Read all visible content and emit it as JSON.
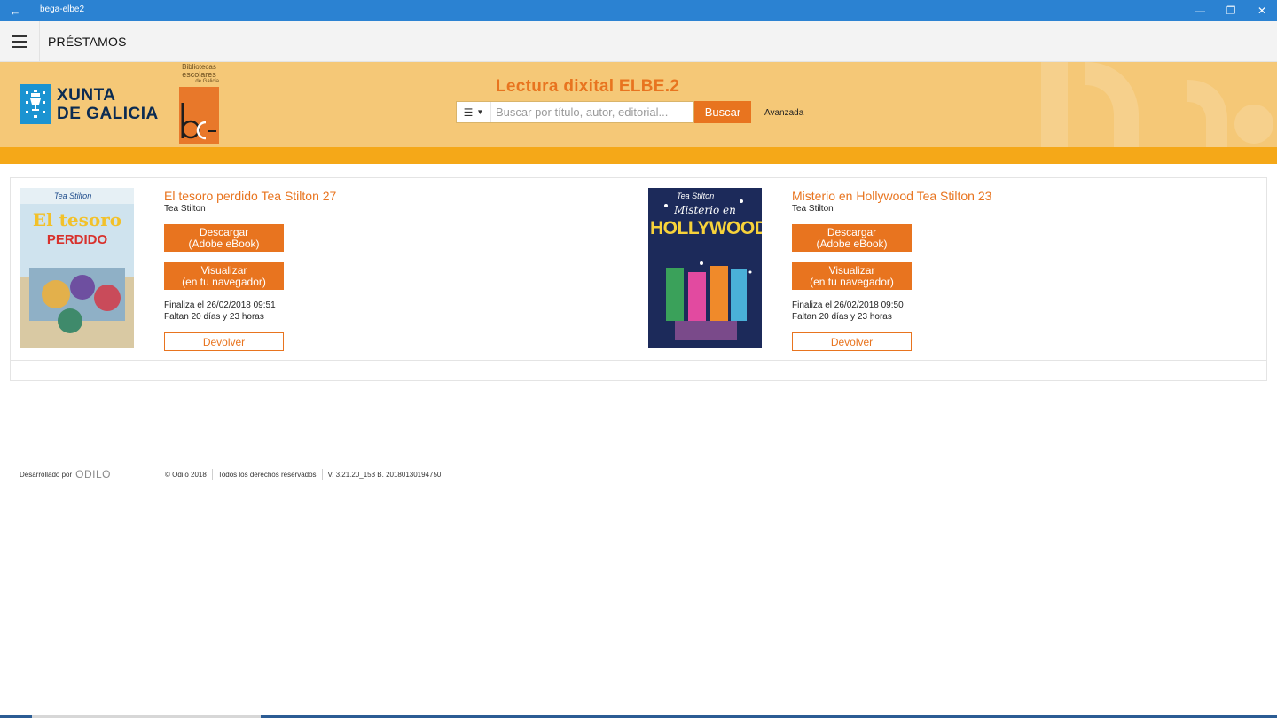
{
  "window": {
    "title": "bega-elbe2",
    "back_icon": "arrow-left-icon",
    "minimize": "—",
    "restore": "❐",
    "close": "✕"
  },
  "appbar": {
    "title": "PRÉSTAMOS"
  },
  "banner": {
    "xunta_line1": "XUNTA",
    "xunta_line2": "DE GALICIA",
    "bega_line1": "Bibliotecas",
    "bega_line2": "escolares",
    "bega_line3": "de Galicia",
    "title": "Lectura dixital ELBE.2",
    "search_placeholder": "Buscar por título, autor, editorial...",
    "search_button": "Buscar",
    "advanced": "Avanzada"
  },
  "loans": [
    {
      "title": "El tesoro perdido Tea Stilton 27",
      "author": "Tea Stilton",
      "download_line1": "Descargar",
      "download_line2": "(Adobe eBook)",
      "view_line1": "Visualizar",
      "view_line2": "(en tu navegador)",
      "ends": "Finaliza el 26/02/2018 09:51",
      "remaining": "Faltan 20 días y 23 horas",
      "return": "Devolver",
      "cover_brand": "Tea Stilton",
      "cover_title1": "El tesoro",
      "cover_title2": "PERDIDO"
    },
    {
      "title": "Misterio en Hollywood Tea Stilton 23",
      "author": "Tea Stilton",
      "download_line1": "Descargar",
      "download_line2": "(Adobe eBook)",
      "view_line1": "Visualizar",
      "view_line2": "(en tu navegador)",
      "ends": "Finaliza el 26/02/2018 09:50",
      "remaining": "Faltan 20 días y 23 horas",
      "return": "Devolver",
      "cover_brand": "Tea Stilton",
      "cover_title1": "Misterio en",
      "cover_title2": "HOLLYWOOD"
    }
  ],
  "footer": {
    "developed_by": "Desarrollado por",
    "brand": "ODILO",
    "copyright": "© Odilo 2018",
    "rights": "Todos los derechos reservados",
    "version": "V. 3.21.20_153 B. 20180130194750"
  },
  "colors": {
    "accent": "#e8741f",
    "banner": "#f5c877",
    "strip": "#f5a818",
    "titlebar": "#2b82d2"
  }
}
